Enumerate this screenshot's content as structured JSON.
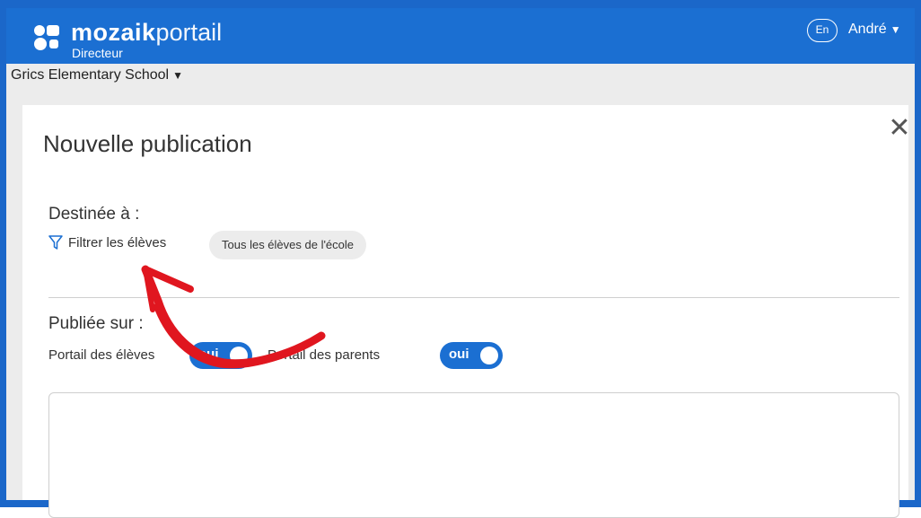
{
  "header": {
    "brand_bold": "mozaik",
    "brand_light": "portail",
    "role": "Directeur",
    "language_badge": "En",
    "user_name": "André"
  },
  "school": {
    "name": "Grics Elementary School"
  },
  "dialog": {
    "title": "Nouvelle publication",
    "destined_label": "Destinée à :",
    "filter_label": "Filtrer les élèves",
    "chip_label": "Tous les élèves de l'école",
    "published_label": "Publiée sur :",
    "student_portal_label": "Portail des élèves",
    "student_portal_toggle": "oui",
    "parent_portal_label": "Portail des parents",
    "parent_portal_toggle": "oui"
  },
  "colors": {
    "frame": "#1b67c9",
    "topbar": "#1b6fd2",
    "toggle": "#1b6fd2",
    "annotation_arrow": "#e0161f"
  },
  "icons": [
    "mozaik-logo-icon",
    "funnel-filter-icon",
    "close-icon",
    "caret-down-icon"
  ]
}
